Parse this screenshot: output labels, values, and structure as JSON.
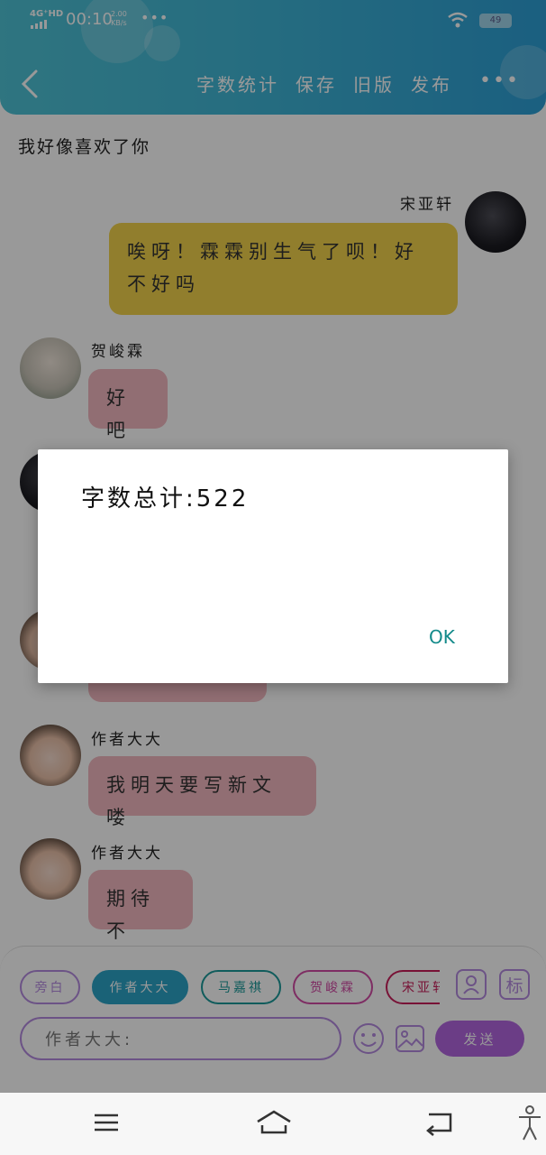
{
  "status": {
    "network": "4G⁺HD",
    "time": "00:10",
    "speed_value": "2.00",
    "speed_unit": "KB/s",
    "more": "•••",
    "battery": "49"
  },
  "header": {
    "actions": [
      "字数统计",
      "保存",
      "旧版",
      "发布"
    ],
    "more": "•••"
  },
  "chat": {
    "narration": "我好像喜欢了你",
    "messages": [
      {
        "sender": "宋亚轩",
        "text": "唉呀！霖霖别生气了呗！好不好吗",
        "side": "right",
        "color": "yellow"
      },
      {
        "sender": "贺峻霖",
        "text": "好吧",
        "side": "left",
        "color": "pink"
      },
      {
        "sender": "作者大大",
        "text": "我明天要写新文喽",
        "side": "left",
        "color": "pink"
      },
      {
        "sender": "作者大大",
        "text": "期待不",
        "side": "left",
        "color": "pink"
      }
    ]
  },
  "dialog": {
    "message": "字数总计:522",
    "ok": "OK"
  },
  "composer": {
    "characters": [
      "旁白",
      "作者大大",
      "马嘉祺",
      "贺峻霖",
      "宋亚轩"
    ],
    "mark_label": "标",
    "input_value": "作者大大:",
    "send": "发送"
  },
  "colors": {
    "header": "#40b6d6",
    "yellow_bubble": "#f2d34c",
    "pink_bubble": "#f2b7c0",
    "accent_purple": "#b267e0",
    "ok_teal": "#138a8a"
  }
}
